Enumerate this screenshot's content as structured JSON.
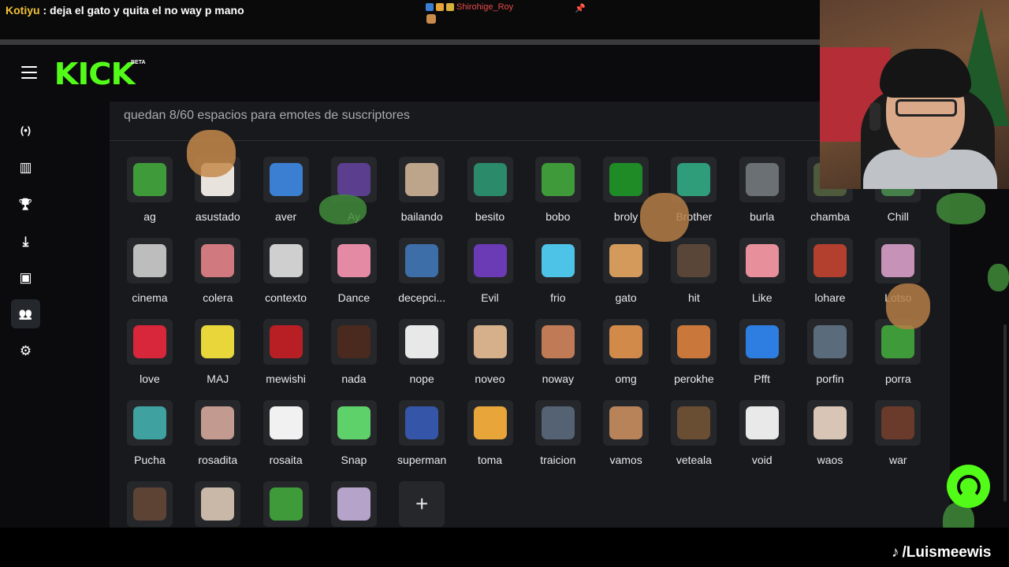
{
  "chat": {
    "username": "Kotiyu",
    "separator": ":",
    "message": "deja el gato y quita el no way p mano",
    "notice_user": "Shirohige_Roy",
    "pin_icon": "pin-icon"
  },
  "header": {
    "logo": "KICK",
    "logo_badge": "BETA",
    "menu_icon": "hamburger-icon"
  },
  "sidebar": {
    "items": [
      {
        "icon": "live-icon",
        "glyph": "(•)"
      },
      {
        "icon": "chart-icon",
        "glyph": "▥"
      },
      {
        "icon": "trophy-icon",
        "glyph": "🏆"
      },
      {
        "icon": "download-icon",
        "glyph": "⤓"
      },
      {
        "icon": "video-icon",
        "glyph": "▣"
      },
      {
        "icon": "users-icon",
        "glyph": "👥",
        "active": true
      },
      {
        "icon": "gear-icon",
        "glyph": "⚙"
      }
    ]
  },
  "panel": {
    "slots_text": "quedan 8/60 espacios para emotes de suscriptores",
    "add_label": "+",
    "emotes": [
      {
        "label": "ag",
        "color": "#3f9b39"
      },
      {
        "label": "asustado",
        "color": "#e9e3dd"
      },
      {
        "label": "aver",
        "color": "#3a7fd1"
      },
      {
        "label": "Ay",
        "color": "#5b3f8e"
      },
      {
        "label": "bailando",
        "color": "#bda58c"
      },
      {
        "label": "besito",
        "color": "#2b8a69"
      },
      {
        "label": "bobo",
        "color": "#3f9b39"
      },
      {
        "label": "broly",
        "color": "#1f8b27"
      },
      {
        "label": "Brother",
        "color": "#2f9d79"
      },
      {
        "label": "burla",
        "color": "#6b7075"
      },
      {
        "label": "chamba",
        "color": "#4e5a3c"
      },
      {
        "label": "Chill",
        "color": "#45804a"
      },
      {
        "label": "cinema",
        "color": "#bdbdbd"
      },
      {
        "label": "colera",
        "color": "#d07a7f"
      },
      {
        "label": "contexto",
        "color": "#cfcfcf"
      },
      {
        "label": "Dance",
        "color": "#e58aa5"
      },
      {
        "label": "decepci...",
        "color": "#3d6ea8"
      },
      {
        "label": "Evil",
        "color": "#6b3ab5"
      },
      {
        "label": "frio",
        "color": "#4ec3e8"
      },
      {
        "label": "gato",
        "color": "#d39a5c"
      },
      {
        "label": "hit",
        "color": "#5a4638"
      },
      {
        "label": "Like",
        "color": "#e7909b"
      },
      {
        "label": "lohare",
        "color": "#b3402f"
      },
      {
        "label": "Lotso",
        "color": "#c792b8"
      },
      {
        "label": "love",
        "color": "#d8263a"
      },
      {
        "label": "MAJ",
        "color": "#e8d63a"
      },
      {
        "label": "mewishi",
        "color": "#b81f24"
      },
      {
        "label": "nada",
        "color": "#4a2a1f"
      },
      {
        "label": "nope",
        "color": "#e8e8e8"
      },
      {
        "label": "noveo",
        "color": "#d6b08a"
      },
      {
        "label": "noway",
        "color": "#c07a55"
      },
      {
        "label": "omg",
        "color": "#d18a4a"
      },
      {
        "label": "perokhe",
        "color": "#c9773a"
      },
      {
        "label": "Pfft",
        "color": "#2e7de0"
      },
      {
        "label": "porfin",
        "color": "#5a6b7c"
      },
      {
        "label": "porra",
        "color": "#3f9b39"
      },
      {
        "label": "Pucha",
        "color": "#3fa1a0"
      },
      {
        "label": "rosadita",
        "color": "#c29a8f"
      },
      {
        "label": "rosaita",
        "color": "#f1f1f1"
      },
      {
        "label": "Snap",
        "color": "#5fd16b"
      },
      {
        "label": "superman",
        "color": "#3555a8"
      },
      {
        "label": "toma",
        "color": "#e7a53a"
      },
      {
        "label": "traicion",
        "color": "#556273"
      },
      {
        "label": "vamos",
        "color": "#b9835a"
      },
      {
        "label": "veteala",
        "color": "#6a4e33"
      },
      {
        "label": "void",
        "color": "#e9e9e9"
      },
      {
        "label": "waos",
        "color": "#d9c5b6"
      },
      {
        "label": "war",
        "color": "#6a3a2a"
      },
      {
        "label": "",
        "color": "#5d4334"
      },
      {
        "label": "",
        "color": "#c9b7a7"
      },
      {
        "label": "",
        "color": "#3f9b39"
      },
      {
        "label": "",
        "color": "#b6a3c9"
      }
    ]
  },
  "footer": {
    "tiktok_handle": "/Luismeewis",
    "tiktok_icon": "tiktok-icon"
  },
  "colors": {
    "brand": "#53fc18",
    "panel_bg": "#18191c",
    "tile_bg": "#25272b"
  }
}
